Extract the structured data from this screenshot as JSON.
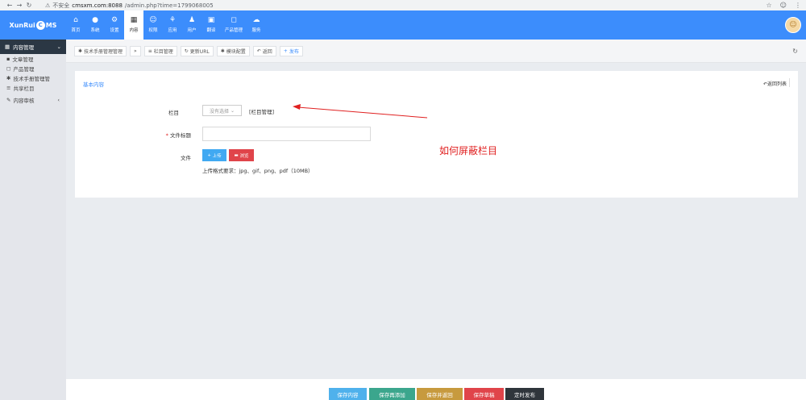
{
  "browser": {
    "security": "不安全",
    "url_host": "cmsxm.com:8088",
    "url_path": "/admin.php?time=1799068005"
  },
  "header": {
    "logo_text": "XunRui",
    "logo_tail": "MS",
    "nav": [
      {
        "label": "首页",
        "icon": "home-icon"
      },
      {
        "label": "系统",
        "icon": "globe-icon"
      },
      {
        "label": "设置",
        "icon": "cogs-icon"
      },
      {
        "label": "内容",
        "icon": "grid-icon"
      },
      {
        "label": "权限",
        "icon": "user-circle-icon"
      },
      {
        "label": "应用",
        "icon": "sitemap-icon"
      },
      {
        "label": "用户",
        "icon": "user-icon"
      },
      {
        "label": "翻译",
        "icon": "translate-icon"
      },
      {
        "label": "产品管理",
        "icon": "bag-icon"
      },
      {
        "label": "服务",
        "icon": "cloud-icon"
      }
    ]
  },
  "sidebar": {
    "head": "内容管理",
    "items": [
      "文章管理",
      "产品管理",
      "技术手册管理管",
      "共享栏目"
    ],
    "group": "内容审核"
  },
  "toolbar": {
    "module": "技术手册管理管理",
    "buttons": [
      "栏目管理",
      "更新URL",
      "模块配置",
      "返回"
    ],
    "publish": "发布"
  },
  "form": {
    "card_title": "基本内容",
    "back_link": "返回列表",
    "label_category": "栏目",
    "select_placeholder": "没有选择",
    "category_link": "[栏目管理]",
    "label_title": "文件标题",
    "label_file": "文件",
    "upload": "上传",
    "browse": "浏览",
    "upload_hint": "上传格式要求：jpg、gif、png、pdf（10MB）",
    "annotation": "如何屏蔽栏目"
  },
  "footer": {
    "buttons": [
      {
        "label": "保存内容",
        "color": "#4fb1ec"
      },
      {
        "label": "保存再添加",
        "color": "#3ba68d"
      },
      {
        "label": "保存并返回",
        "color": "#c79a3e"
      },
      {
        "label": "保存草稿",
        "color": "#e0444a"
      },
      {
        "label": "定时发布",
        "color": "#2f353b"
      }
    ]
  }
}
